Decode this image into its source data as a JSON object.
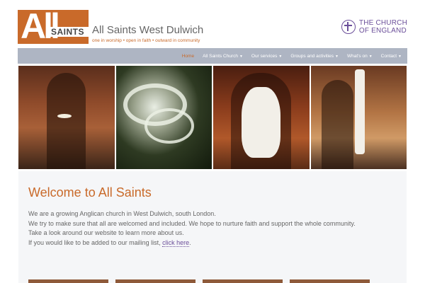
{
  "header": {
    "logo_big": "All",
    "logo_saints": "SAINTS",
    "site_title": "All Saints West Dulwich",
    "tagline": "one in worship • open in faith • outward in community",
    "coe_line1": "THE CHURCH",
    "coe_line2": "OF ENGLAND"
  },
  "nav": {
    "items": [
      {
        "label": "Home",
        "caret": ""
      },
      {
        "label": "All Saints Church",
        "caret": "▼"
      },
      {
        "label": "Our services",
        "caret": "▼"
      },
      {
        "label": "Groups and activities",
        "caret": "▼"
      },
      {
        "label": "What's on",
        "caret": "▼"
      },
      {
        "label": "Contact",
        "caret": "▼"
      }
    ]
  },
  "welcome": {
    "title": "Welcome to All Saints",
    "line1": "We are a growing Anglican church in West Dulwich, south London.",
    "line2": "We try to make sure that all are welcomed and included. We hope to nurture faith and support the whole community.",
    "line3": "Take a look around our website to learn more about us.",
    "line4_prefix": "If you would like to be added to our mailing list, ",
    "line4_link": "click here",
    "line4_suffix": "."
  },
  "colors": {
    "accent": "#c96a2a",
    "nav_bg": "#aeb5c3",
    "coe": "#6b4f9a"
  }
}
